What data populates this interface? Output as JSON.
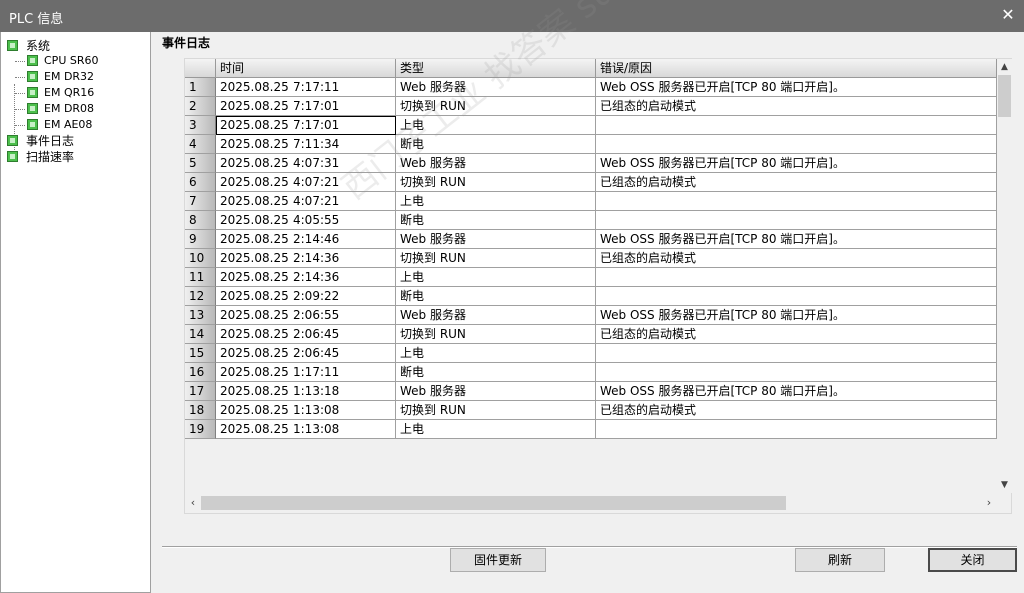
{
  "window": {
    "title": "PLC 信息",
    "close_symbol": "✕"
  },
  "tree": {
    "root": "系统",
    "children": [
      "CPU SR60",
      "EM DR32",
      "EM QR16",
      "EM DR08",
      "EM AE08"
    ],
    "event_log": "事件日志",
    "scan_rate": "扫描速率",
    "icon": "green-square-icon"
  },
  "section_title": "事件日志",
  "table": {
    "columns": [
      "时间",
      "类型",
      "错误/原因"
    ],
    "rows": [
      {
        "n": "1",
        "date": "2025.08.25",
        "time": "7:17:11",
        "type": "Web 服务器",
        "reason": "Web OSS 服务器已开启[TCP 80 端口开启]。"
      },
      {
        "n": "2",
        "date": "2025.08.25",
        "time": "7:17:01",
        "type": "切换到 RUN",
        "reason": "已组态的启动模式"
      },
      {
        "n": "3",
        "date": "2025.08.25",
        "time": "7:17:01",
        "type": "上电",
        "reason": ""
      },
      {
        "n": "4",
        "date": "2025.08.25",
        "time": "7:11:34",
        "type": "断电",
        "reason": ""
      },
      {
        "n": "5",
        "date": "2025.08.25",
        "time": "4:07:31",
        "type": "Web 服务器",
        "reason": "Web OSS 服务器已开启[TCP 80 端口开启]。"
      },
      {
        "n": "6",
        "date": "2025.08.25",
        "time": "4:07:21",
        "type": "切换到 RUN",
        "reason": "已组态的启动模式"
      },
      {
        "n": "7",
        "date": "2025.08.25",
        "time": "4:07:21",
        "type": "上电",
        "reason": ""
      },
      {
        "n": "8",
        "date": "2025.08.25",
        "time": "4:05:55",
        "type": "断电",
        "reason": ""
      },
      {
        "n": "9",
        "date": "2025.08.25",
        "time": "2:14:46",
        "type": "Web 服务器",
        "reason": "Web OSS 服务器已开启[TCP 80 端口开启]。"
      },
      {
        "n": "10",
        "date": "2025.08.25",
        "time": "2:14:36",
        "type": "切换到 RUN",
        "reason": "已组态的启动模式"
      },
      {
        "n": "11",
        "date": "2025.08.25",
        "time": "2:14:36",
        "type": "上电",
        "reason": ""
      },
      {
        "n": "12",
        "date": "2025.08.25",
        "time": "2:09:22",
        "type": "断电",
        "reason": ""
      },
      {
        "n": "13",
        "date": "2025.08.25",
        "time": "2:06:55",
        "type": "Web 服务器",
        "reason": "Web OSS 服务器已开启[TCP 80 端口开启]。"
      },
      {
        "n": "14",
        "date": "2025.08.25",
        "time": "2:06:45",
        "type": "切换到 RUN",
        "reason": "已组态的启动模式"
      },
      {
        "n": "15",
        "date": "2025.08.25",
        "time": "2:06:45",
        "type": "上电",
        "reason": ""
      },
      {
        "n": "16",
        "date": "2025.08.25",
        "time": "1:17:11",
        "type": "断电",
        "reason": ""
      },
      {
        "n": "17",
        "date": "2025.08.25",
        "time": "1:13:18",
        "type": "Web 服务器",
        "reason": "Web OSS 服务器已开启[TCP 80 端口开启]。"
      },
      {
        "n": "18",
        "date": "2025.08.25",
        "time": "1:13:08",
        "type": "切换到 RUN",
        "reason": "已组态的启动模式"
      },
      {
        "n": "19",
        "date": "2025.08.25",
        "time": "1:13:08",
        "type": "上电",
        "reason": ""
      }
    ],
    "selected_row": 3
  },
  "buttons": {
    "firmware": "固件更新",
    "refresh": "刷新",
    "close": "关闭"
  },
  "watermark": "西门子工业 找答案 support.industry.siemens.com/cs"
}
